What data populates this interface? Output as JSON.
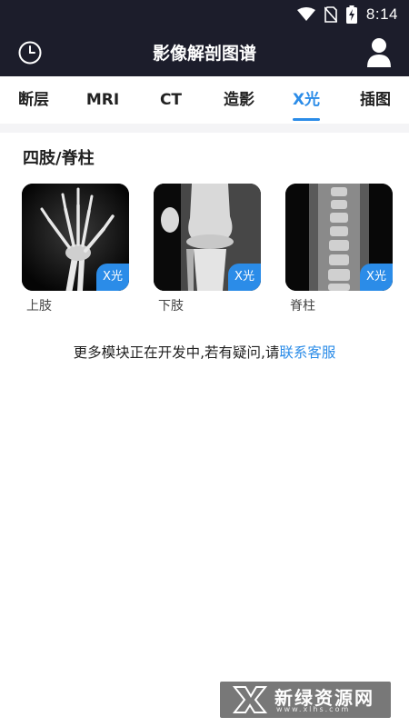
{
  "status_bar": {
    "time": "8:14",
    "icons": [
      "wifi-icon",
      "no-sim-icon",
      "battery-charging-icon"
    ]
  },
  "app_bar": {
    "title": "影像解剖图谱",
    "left_icon": "history-clock-icon",
    "right_icon": "user-profile-icon"
  },
  "tabs": [
    {
      "label": "断层"
    },
    {
      "label": "MRI"
    },
    {
      "label": "CT"
    },
    {
      "label": "造影"
    },
    {
      "label": "X光",
      "active": true
    },
    {
      "label": "插图"
    }
  ],
  "section": {
    "title": "四肢/脊柱",
    "cards": [
      {
        "label": "上肢",
        "badge": "X光"
      },
      {
        "label": "下肢",
        "badge": "X光"
      },
      {
        "label": "脊柱",
        "badge": "X光"
      }
    ]
  },
  "notice": {
    "text": "更多模块正在开发中,若有疑问,请",
    "link": "联系客服"
  },
  "watermark": {
    "text": "新绿资源网",
    "url": "www.xlhs.com"
  },
  "colors": {
    "header_bg": "#1c1d2b",
    "accent": "#2b8ce8"
  }
}
